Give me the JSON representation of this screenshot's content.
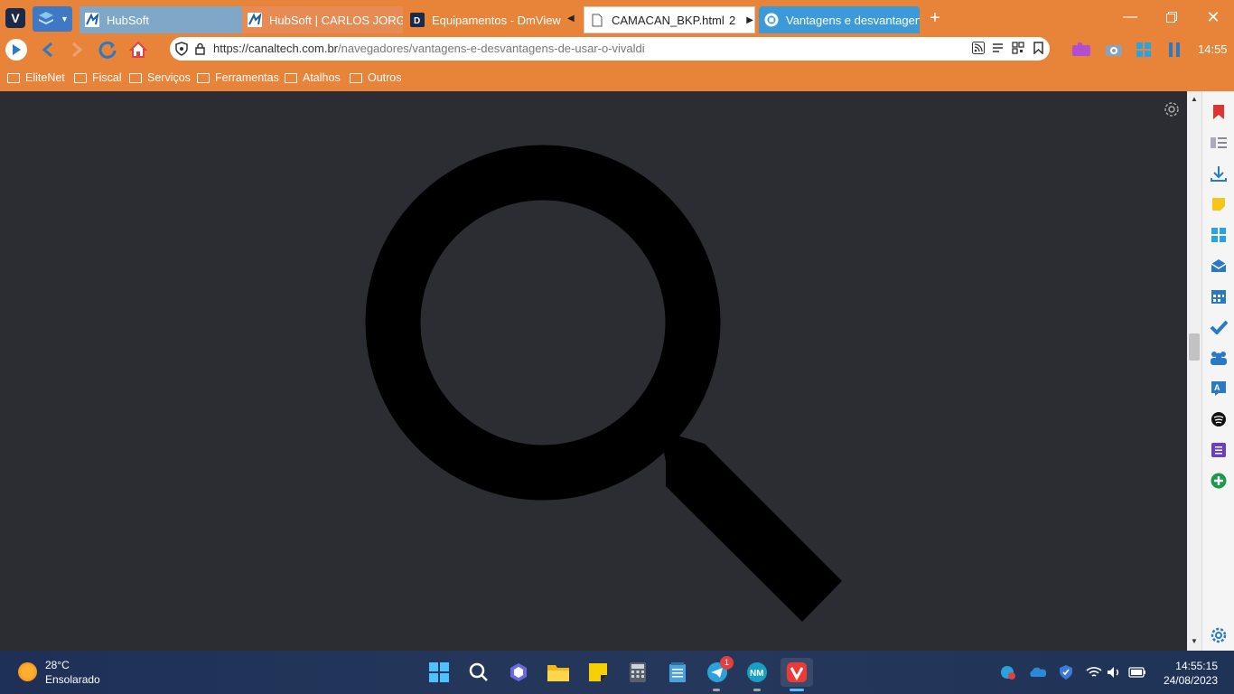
{
  "tabs": [
    {
      "title": "HubSoft"
    },
    {
      "title": "HubSoft | CARLOS JORGE L"
    },
    {
      "title": "Equipamentos - DmView"
    },
    {
      "title": "CAMACAN_BKP.html",
      "count": "2"
    },
    {
      "title": "Vantagens e desvantagens"
    }
  ],
  "address": {
    "url_domain": "https://canaltech.com.br",
    "url_path": "/navegadores/vantagens-e-desvantagens-de-usar-o-vivaldi"
  },
  "clock": "14:55",
  "bookmarks": [
    "EliteNet",
    "Fiscal",
    "Serviços",
    "Ferramentas",
    "Atalhos",
    "Outros"
  ],
  "page": {
    "main_image_icon": "search-icon"
  },
  "weather": {
    "temp": "28°C",
    "desc": "Ensolarado"
  },
  "taskbar": {
    "time": "14:55:15",
    "date": "24/08/2023",
    "telegram_badge": "1"
  },
  "colors": {
    "accent": "#e8843a",
    "page_bg": "#2c2c33",
    "active_tab": "#3c9ad8"
  }
}
